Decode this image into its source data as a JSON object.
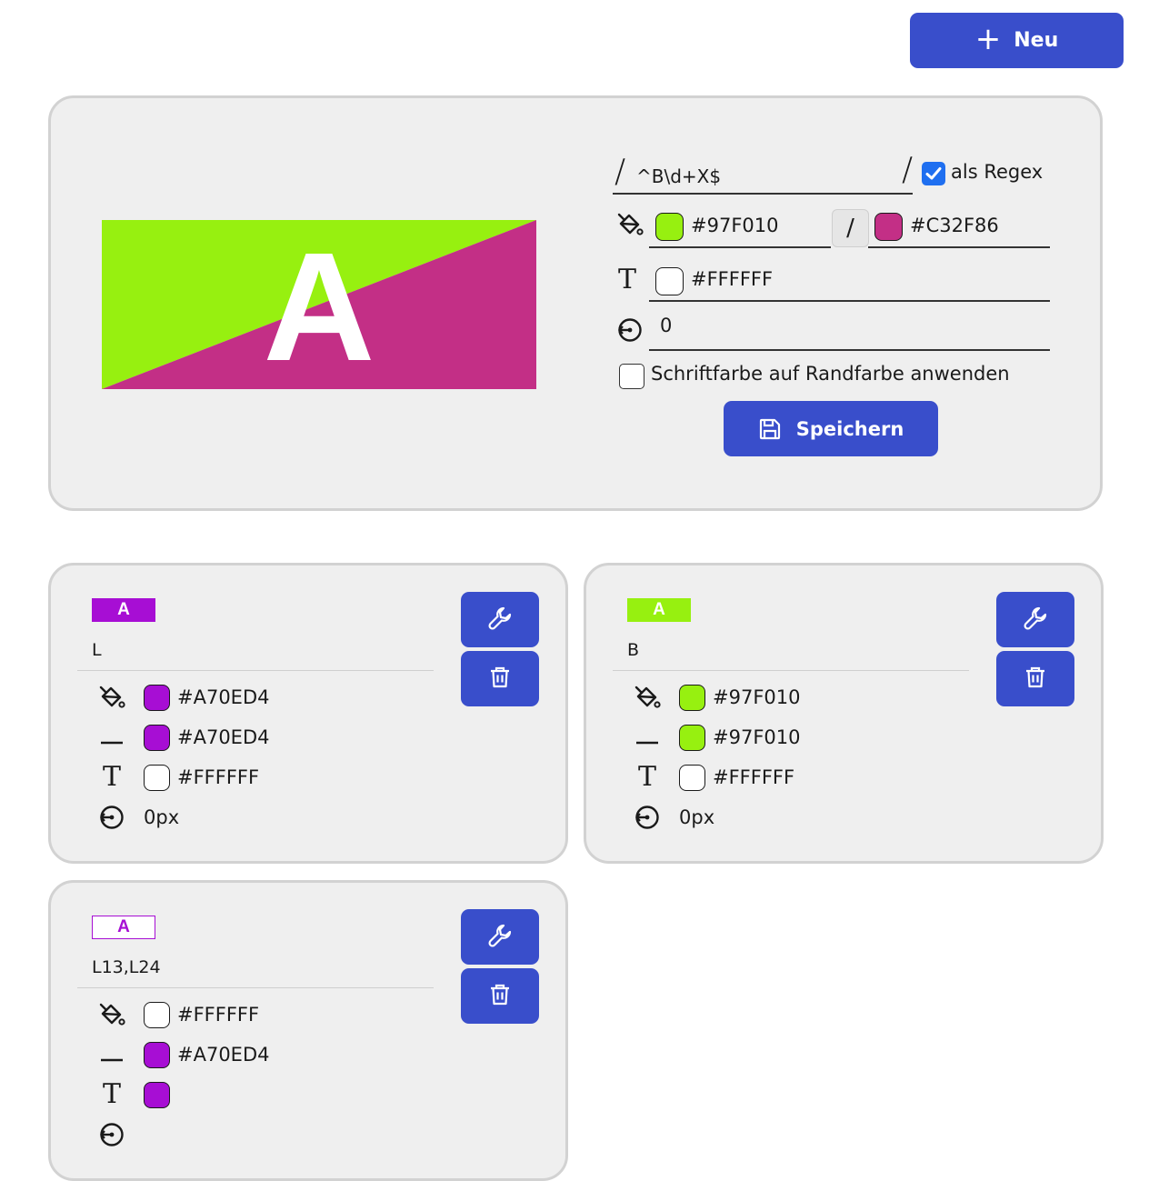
{
  "toolbar": {
    "new_label": "Neu"
  },
  "editor": {
    "preview_letter": "A",
    "regex_value": "^B\\d+X$",
    "regex_slash": "/",
    "as_regex_label": "als Regex",
    "as_regex_checked": true,
    "fill_color_a": "#97F010",
    "fill_color_b": "#C32F86",
    "swap_label": "/",
    "text_color": "#FFFFFF",
    "radius_value": "0",
    "apply_font_color_label": "Schriftfarbe auf Randfarbe anwenden",
    "save_label": "Speichern"
  },
  "cards": [
    {
      "badge": "A",
      "name": "L",
      "badge_bg": "#A70ED4",
      "badge_fg": "#FFFFFF",
      "badge_border": "#A70ED4",
      "fill_color": "#A70ED4",
      "border_color": "#A70ED4",
      "text_color": "#FFFFFF",
      "radius": "0px"
    },
    {
      "badge": "A",
      "name": "B",
      "badge_bg": "#97F010",
      "badge_fg": "#FFFFFF",
      "badge_border": "#97F010",
      "fill_color": "#97F010",
      "border_color": "#97F010",
      "text_color": "#FFFFFF",
      "radius": "0px"
    },
    {
      "badge": "A",
      "name": "L13,L24",
      "badge_bg": "#FFFFFF",
      "badge_fg": "#A70ED4",
      "badge_border": "#A70ED4",
      "fill_color": "#FFFFFF",
      "border_color": "#A70ED4",
      "text_color": "",
      "radius": ""
    }
  ],
  "icons": {
    "new": "plus-icon",
    "fill": "paint-bucket-icon",
    "border": "line-icon",
    "text": "text-t-icon",
    "radius": "radius-icon",
    "save": "floppy-disk-icon",
    "edit": "wrench-icon",
    "delete": "trash-icon"
  }
}
